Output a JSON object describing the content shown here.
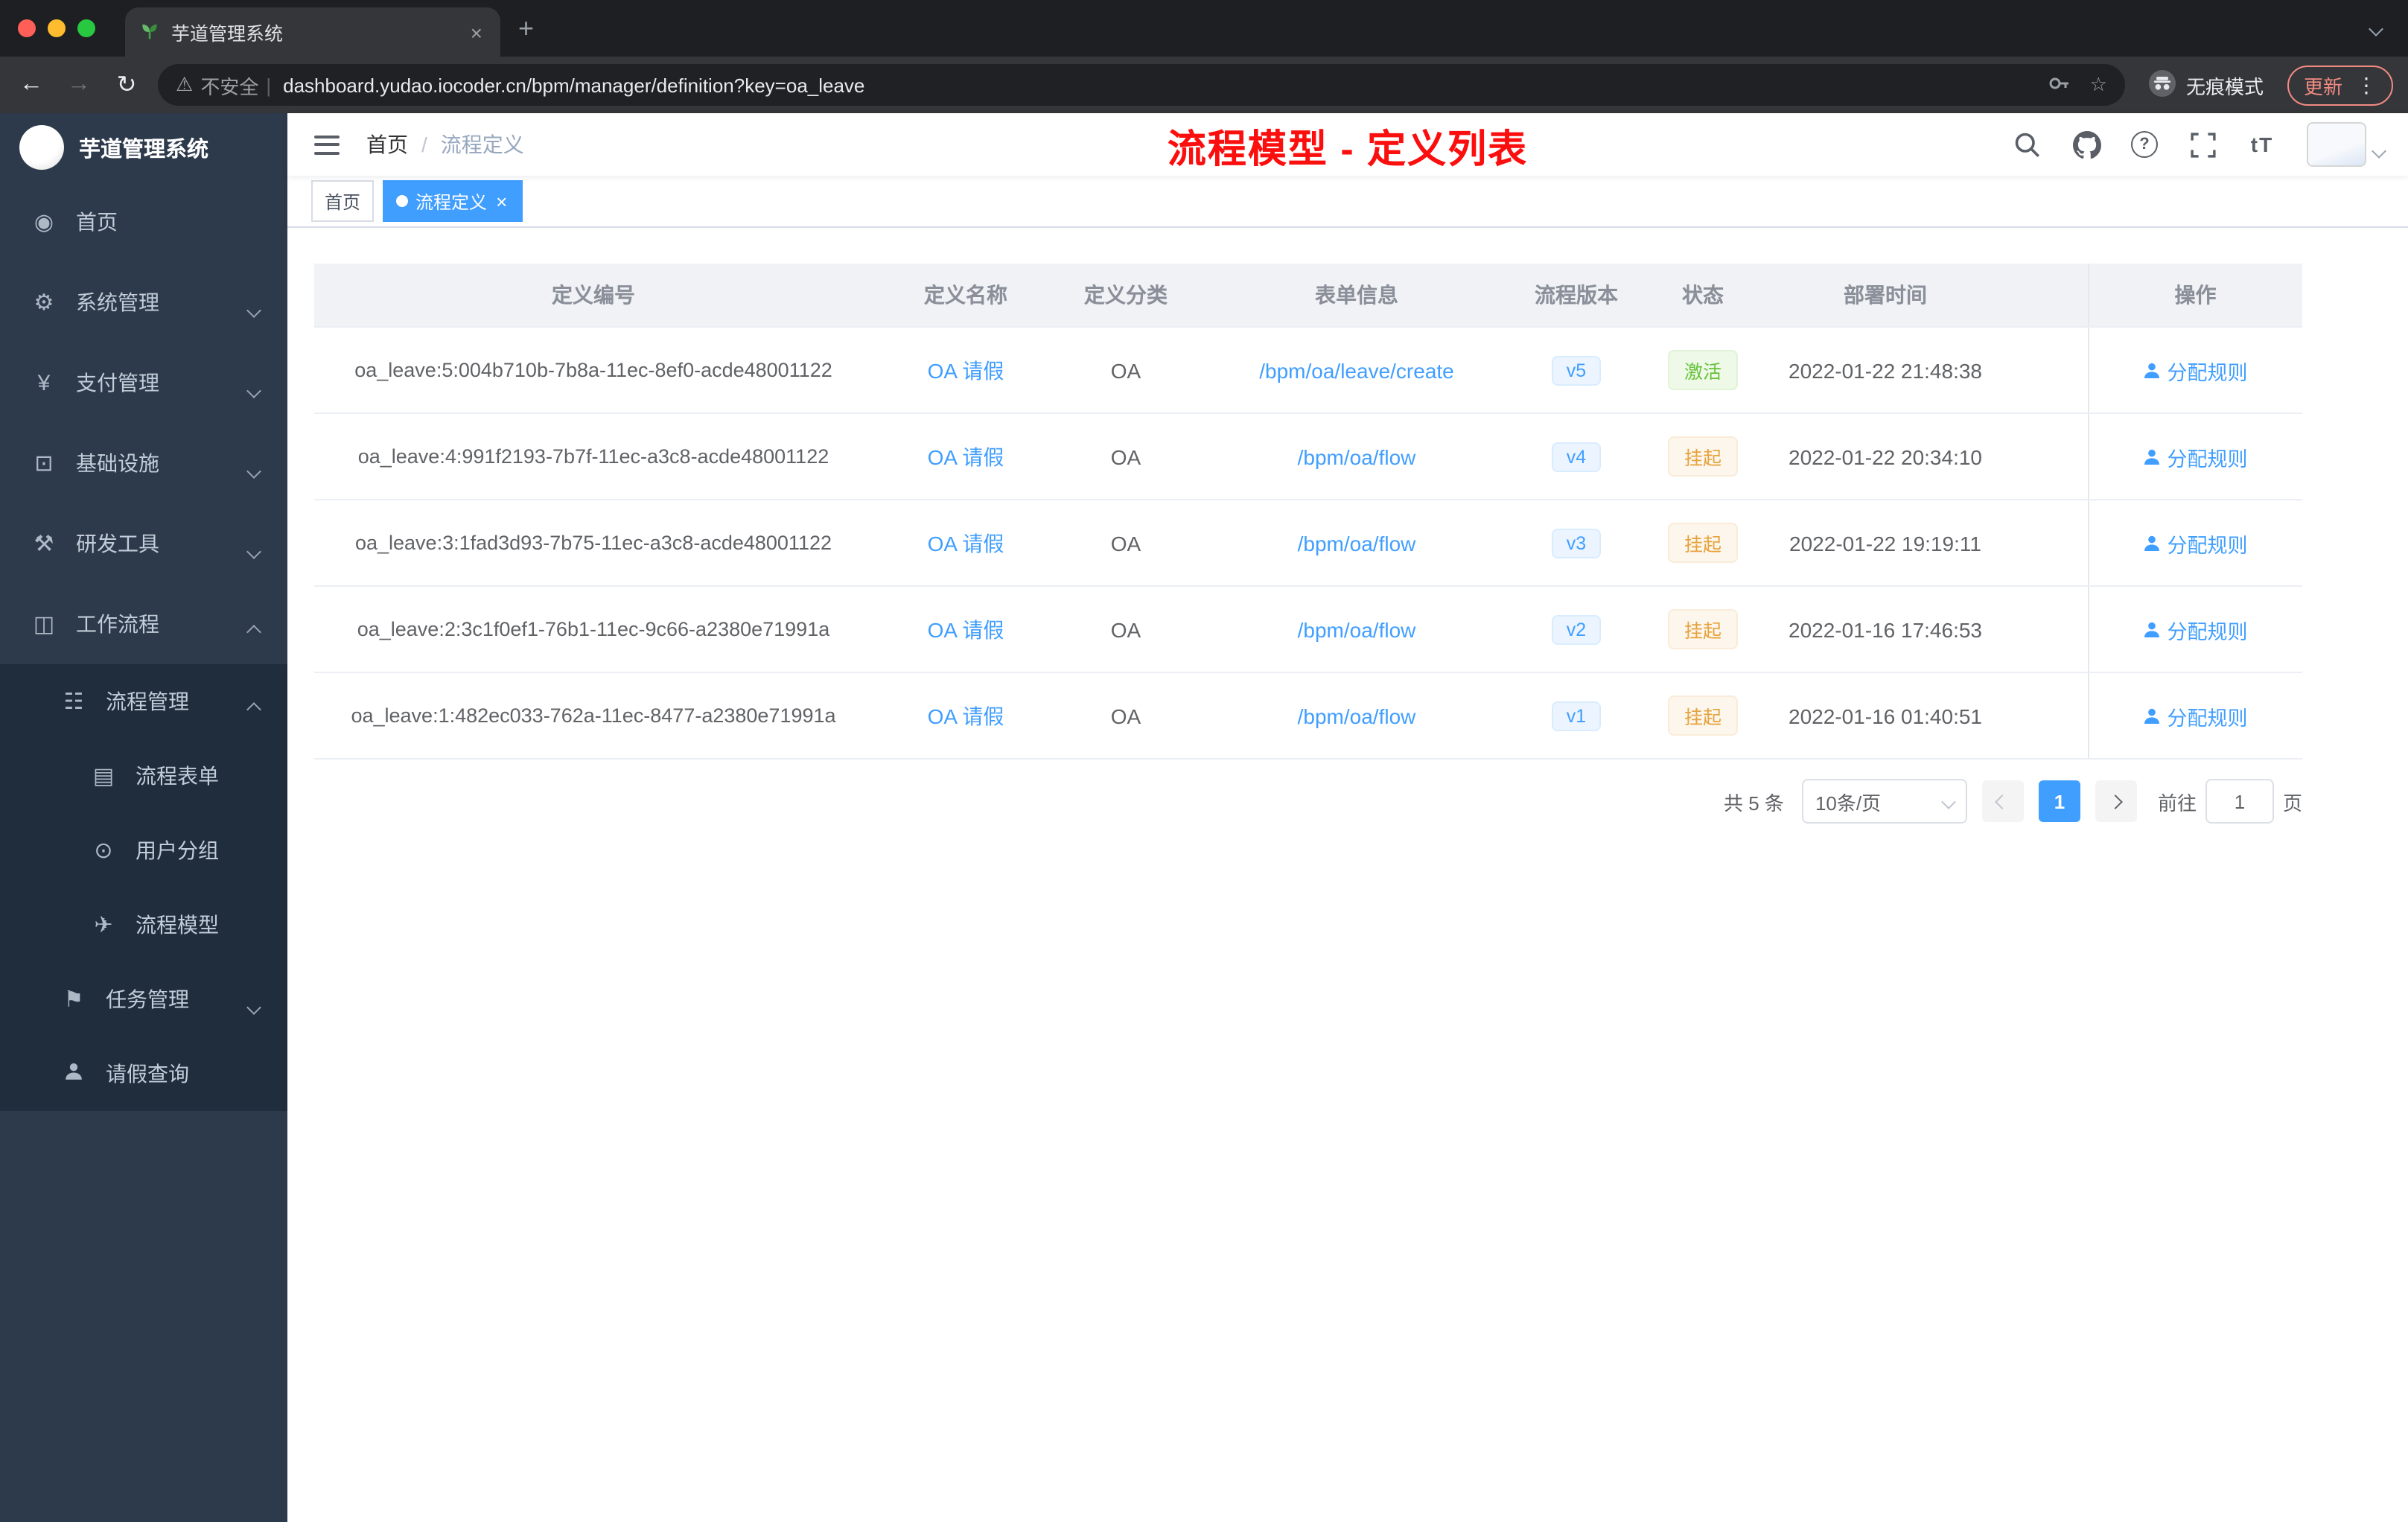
{
  "browser": {
    "tab": {
      "title": "芋道管理系统"
    },
    "address": {
      "security_label": "不安全",
      "url": "dashboard.yudao.iocoder.cn/bpm/manager/definition?key=oa_leave",
      "incognito_label": "无痕模式",
      "update_label": "更新"
    }
  },
  "glyphs": {
    "plus": "+",
    "close": "×",
    "back": "←",
    "forward": "→",
    "reload": "↻",
    "kebab": "⋮",
    "star": "☆",
    "warning": "⚠",
    "divider": "|",
    "question": "?",
    "font_size": "tT"
  },
  "sidebar": {
    "title": "芋道管理系统",
    "menu": [
      {
        "label": "首页",
        "icon": "dashboard-icon",
        "glyph": "◉"
      },
      {
        "label": "系统管理",
        "icon": "gear-icon",
        "glyph": "⚙"
      },
      {
        "label": "支付管理",
        "icon": "yen-icon",
        "glyph": "¥"
      },
      {
        "label": "基础设施",
        "icon": "infrastructure-icon",
        "glyph": "⊡"
      },
      {
        "label": "研发工具",
        "icon": "dev-tools-icon",
        "glyph": "⚒"
      },
      {
        "label": "工作流程",
        "icon": "workflow-icon",
        "glyph": "◫"
      }
    ],
    "submenu": [
      {
        "label": "流程管理",
        "icon": "list-icon",
        "glyph": "☷"
      },
      {
        "label": "流程表单",
        "icon": "form-icon",
        "glyph": "▤"
      },
      {
        "label": "用户分组",
        "icon": "user-group-icon",
        "glyph": "⊙"
      },
      {
        "label": "流程模型",
        "icon": "paper-plane-icon",
        "glyph": "✈"
      },
      {
        "label": "任务管理",
        "icon": "task-icon",
        "glyph": "⚑"
      },
      {
        "label": "请假查询",
        "icon": "user-icon",
        "glyph": ""
      }
    ]
  },
  "header": {
    "breadcrumb": {
      "home": "首页",
      "separator": "/",
      "current": "流程定义"
    },
    "annotation": "流程模型 - 定义列表",
    "icons": [
      "search-icon",
      "github-icon",
      "question-icon",
      "fullscreen-icon",
      "font-size-icon"
    ]
  },
  "tags": [
    {
      "label": "首页",
      "active": false
    },
    {
      "label": "流程定义",
      "active": true
    }
  ],
  "table": {
    "headers": [
      "定义编号",
      "定义名称",
      "定义分类",
      "表单信息",
      "流程版本",
      "状态",
      "部署时间",
      "操作"
    ],
    "rows": [
      {
        "id": "oa_leave:5:004b710b-7b8a-11ec-8ef0-acde48001122",
        "name": "OA 请假",
        "category": "OA",
        "form": "/bpm/oa/leave/create",
        "version": "v5",
        "status": "激活",
        "status_type": "success",
        "deploy_time": "2022-01-22 21:48:38",
        "action": "分配规则"
      },
      {
        "id": "oa_leave:4:991f2193-7b7f-11ec-a3c8-acde48001122",
        "name": "OA 请假",
        "category": "OA",
        "form": "/bpm/oa/flow",
        "version": "v4",
        "status": "挂起",
        "status_type": "warning",
        "deploy_time": "2022-01-22 20:34:10",
        "action": "分配规则"
      },
      {
        "id": "oa_leave:3:1fad3d93-7b75-11ec-a3c8-acde48001122",
        "name": "OA 请假",
        "category": "OA",
        "form": "/bpm/oa/flow",
        "version": "v3",
        "status": "挂起",
        "status_type": "warning",
        "deploy_time": "2022-01-22 19:19:11",
        "action": "分配规则"
      },
      {
        "id": "oa_leave:2:3c1f0ef1-76b1-11ec-9c66-a2380e71991a",
        "name": "OA 请假",
        "category": "OA",
        "form": "/bpm/oa/flow",
        "version": "v2",
        "status": "挂起",
        "status_type": "warning",
        "deploy_time": "2022-01-16 17:46:53",
        "action": "分配规则"
      },
      {
        "id": "oa_leave:1:482ec033-762a-11ec-8477-a2380e71991a",
        "name": "OA 请假",
        "category": "OA",
        "form": "/bpm/oa/flow",
        "version": "v1",
        "status": "挂起",
        "status_type": "warning",
        "deploy_time": "2022-01-16 01:40:51",
        "action": "分配规则"
      }
    ]
  },
  "pagination": {
    "total": "共 5 条",
    "page_size": "10条/页",
    "current_page": "1",
    "goto_label": "前往",
    "goto_value": "1",
    "goto_unit": "页"
  },
  "colors": {
    "accent": "#409EFF",
    "success": "#67C23A",
    "warning": "#E6A23C",
    "annotation_red": "#FB0E0E",
    "sidebar_bg": "#2D3A4B",
    "submenu_bg": "#1F2D3D"
  }
}
